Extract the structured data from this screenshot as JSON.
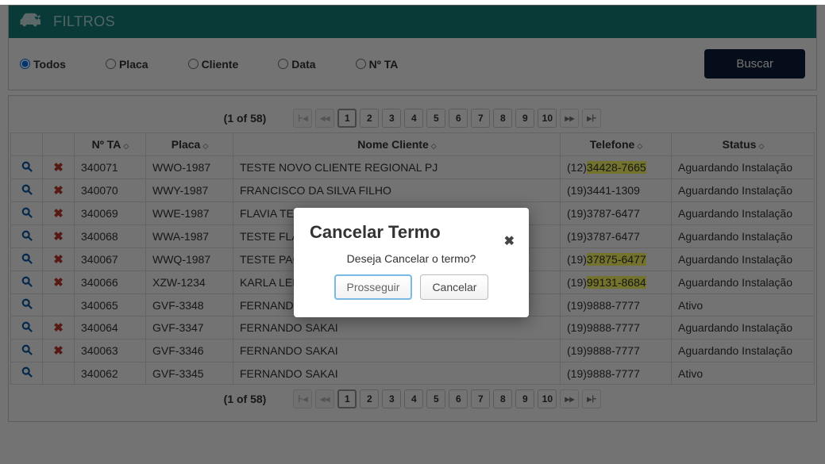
{
  "filter": {
    "title": "FILTROS",
    "options": [
      {
        "label": "Todos",
        "checked": true
      },
      {
        "label": "Placa",
        "checked": false
      },
      {
        "label": "Cliente",
        "checked": false
      },
      {
        "label": "Data",
        "checked": false
      },
      {
        "label": "Nº TA",
        "checked": false
      }
    ],
    "search_label": "Buscar"
  },
  "paginator": {
    "info": "(1 of 58)",
    "nav": {
      "first": "⊦◂",
      "prev": "◂◂",
      "next": "▸▸",
      "last": "▸⊦"
    },
    "pages": [
      "1",
      "2",
      "3",
      "4",
      "5",
      "6",
      "7",
      "8",
      "9",
      "10"
    ],
    "active": "1"
  },
  "table": {
    "headers": {
      "ta": "Nº TA",
      "placa": "Placa",
      "nome": "Nome Cliente",
      "tel": "Telefone",
      "status": "Status"
    },
    "rows": [
      {
        "ta": "340071",
        "placa": "WWO-1987",
        "nome": "TESTE NOVO CLIENTE REGIONAL PJ",
        "tel_prefix": "(12)",
        "tel_num": "34428-7665",
        "tel_hl": true,
        "status": "Aguardando Instalação",
        "cancel": true
      },
      {
        "ta": "340070",
        "placa": "WWY-1987",
        "nome": "FRANCISCO DA SILVA FILHO",
        "tel_prefix": "(19)",
        "tel_num": "3441-1309",
        "tel_hl": false,
        "status": "Aguardando Instalação",
        "cancel": true
      },
      {
        "ta": "340069",
        "placa": "WWE-1987",
        "nome": "FLAVIA TESTE",
        "tel_prefix": "(19)",
        "tel_num": "3787-6477",
        "tel_hl": false,
        "status": "Aguardando Instalação",
        "cancel": true
      },
      {
        "ta": "340068",
        "placa": "WWA-1987",
        "nome": "TESTE FLAVIA",
        "tel_prefix": "(19)",
        "tel_num": "3787-6477",
        "tel_hl": false,
        "status": "Aguardando Instalação",
        "cancel": true
      },
      {
        "ta": "340067",
        "placa": "WWQ-1987",
        "nome": "TESTE PAGINA",
        "tel_prefix": "(19)",
        "tel_num": "37875-6477",
        "tel_hl": true,
        "status": "Aguardando Instalação",
        "cancel": true
      },
      {
        "ta": "340066",
        "placa": "XZW-1234",
        "nome": "KARLA LEITE",
        "tel_prefix": "(19)",
        "tel_num": "99131-8684",
        "tel_hl": true,
        "status": "Aguardando Instalação",
        "cancel": true
      },
      {
        "ta": "340065",
        "placa": "GVF-3348",
        "nome": "FERNANDO SAKAI",
        "tel_prefix": "(19)",
        "tel_num": "9888-7777",
        "tel_hl": false,
        "status": "Ativo",
        "cancel": false
      },
      {
        "ta": "340064",
        "placa": "GVF-3347",
        "nome": "FERNANDO SAKAI",
        "tel_prefix": "(19)",
        "tel_num": "9888-7777",
        "tel_hl": false,
        "status": "Aguardando Instalação",
        "cancel": true
      },
      {
        "ta": "340063",
        "placa": "GVF-3346",
        "nome": "FERNANDO SAKAI",
        "tel_prefix": "(19)",
        "tel_num": "9888-7777",
        "tel_hl": false,
        "status": "Aguardando Instalação",
        "cancel": true
      },
      {
        "ta": "340062",
        "placa": "GVF-3345",
        "nome": "FERNANDO SAKAI",
        "tel_prefix": "(19)",
        "tel_num": "9888-7777",
        "tel_hl": false,
        "status": "Ativo",
        "cancel": false
      }
    ]
  },
  "modal": {
    "title": "Cancelar Termo",
    "message": "Deseja Cancelar o termo?",
    "proceed": "Prosseguir",
    "cancel": "Cancelar"
  }
}
